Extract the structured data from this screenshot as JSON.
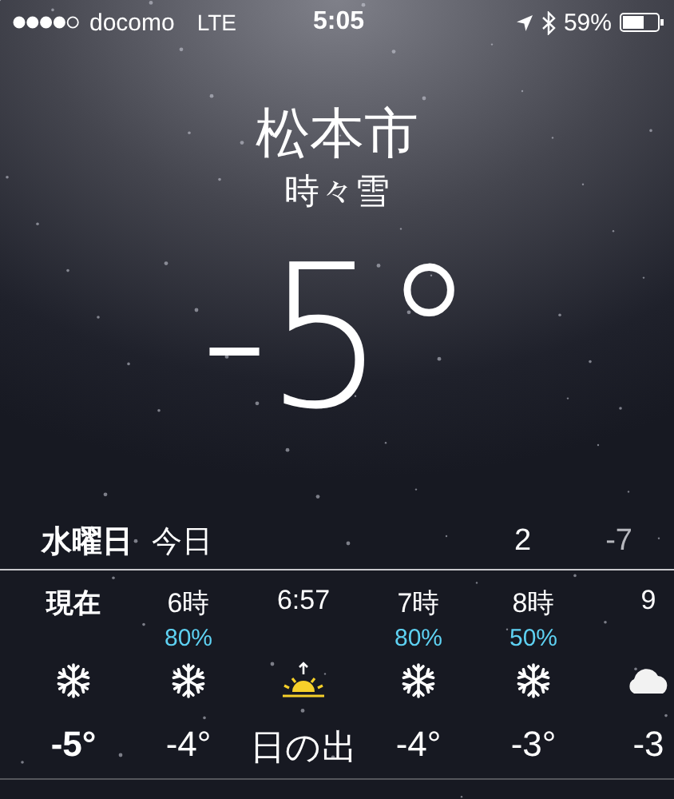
{
  "status_bar": {
    "carrier": "docomo",
    "network": "LTE",
    "time": "5:05",
    "battery": "59%"
  },
  "city": "松本市",
  "condition": "時々雪",
  "temperature": "-5°",
  "day": {
    "weekday": "水曜日",
    "label": "今日",
    "high": "2",
    "low": "-7"
  },
  "hourly": [
    {
      "time": "現在",
      "current": true,
      "kind": "snow",
      "temp": "-5°"
    },
    {
      "time": "6時",
      "current": false,
      "precip": "80%",
      "kind": "snow",
      "temp": "-4°"
    },
    {
      "time": "6:57",
      "current": false,
      "kind": "sunrise",
      "temp": "日の出"
    },
    {
      "time": "7時",
      "current": false,
      "precip": "80%",
      "kind": "snow",
      "temp": "-4°"
    },
    {
      "time": "8時",
      "current": false,
      "precip": "50%",
      "kind": "snow",
      "temp": "-3°"
    },
    {
      "time": "9",
      "current": false,
      "kind": "cloud",
      "temp": "-3"
    }
  ]
}
